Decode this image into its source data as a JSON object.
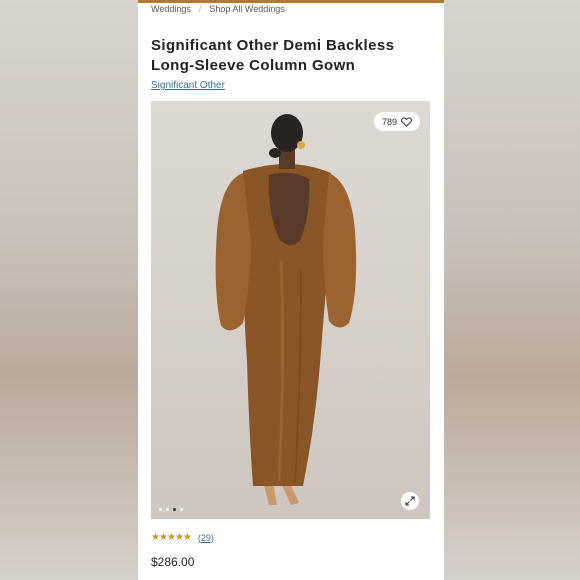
{
  "breadcrumb": {
    "items": [
      "Weddings",
      "Shop All Weddings"
    ],
    "separator": "/"
  },
  "product": {
    "title": "Significant Other Demi Backless Long-Sleeve Column Gown",
    "brand": "Significant Other",
    "favorites": "789",
    "rating": {
      "stars": 4.5,
      "stars_display": "★★★★★",
      "review_count": "(29)"
    },
    "price": "$286.00",
    "image": {
      "carousel_dots": 4,
      "active_dot": 3
    }
  },
  "colors": {
    "accent": "#b07a32",
    "link": "#3a6a8a",
    "dress": "#8a5527",
    "star": "#c9922f"
  }
}
